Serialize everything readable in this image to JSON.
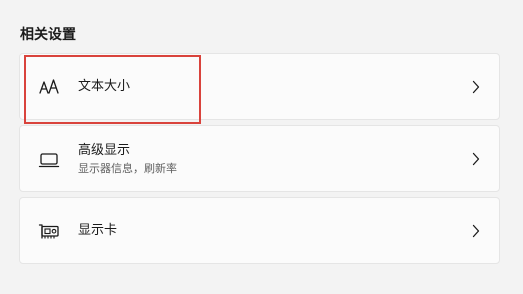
{
  "section": {
    "title": "相关设置"
  },
  "items": [
    {
      "title": "文本大小",
      "subtitle": "",
      "icon": "text-size-icon"
    },
    {
      "title": "高级显示",
      "subtitle": "显示器信息，刷新率",
      "icon": "monitor-icon"
    },
    {
      "title": "显示卡",
      "subtitle": "",
      "icon": "graphics-card-icon"
    }
  ],
  "colors": {
    "background": "#f3f3f3",
    "card": "#fbfbfb",
    "card_border": "#e5e5e5",
    "highlight": "#d9433c",
    "subtitle": "#606060"
  }
}
